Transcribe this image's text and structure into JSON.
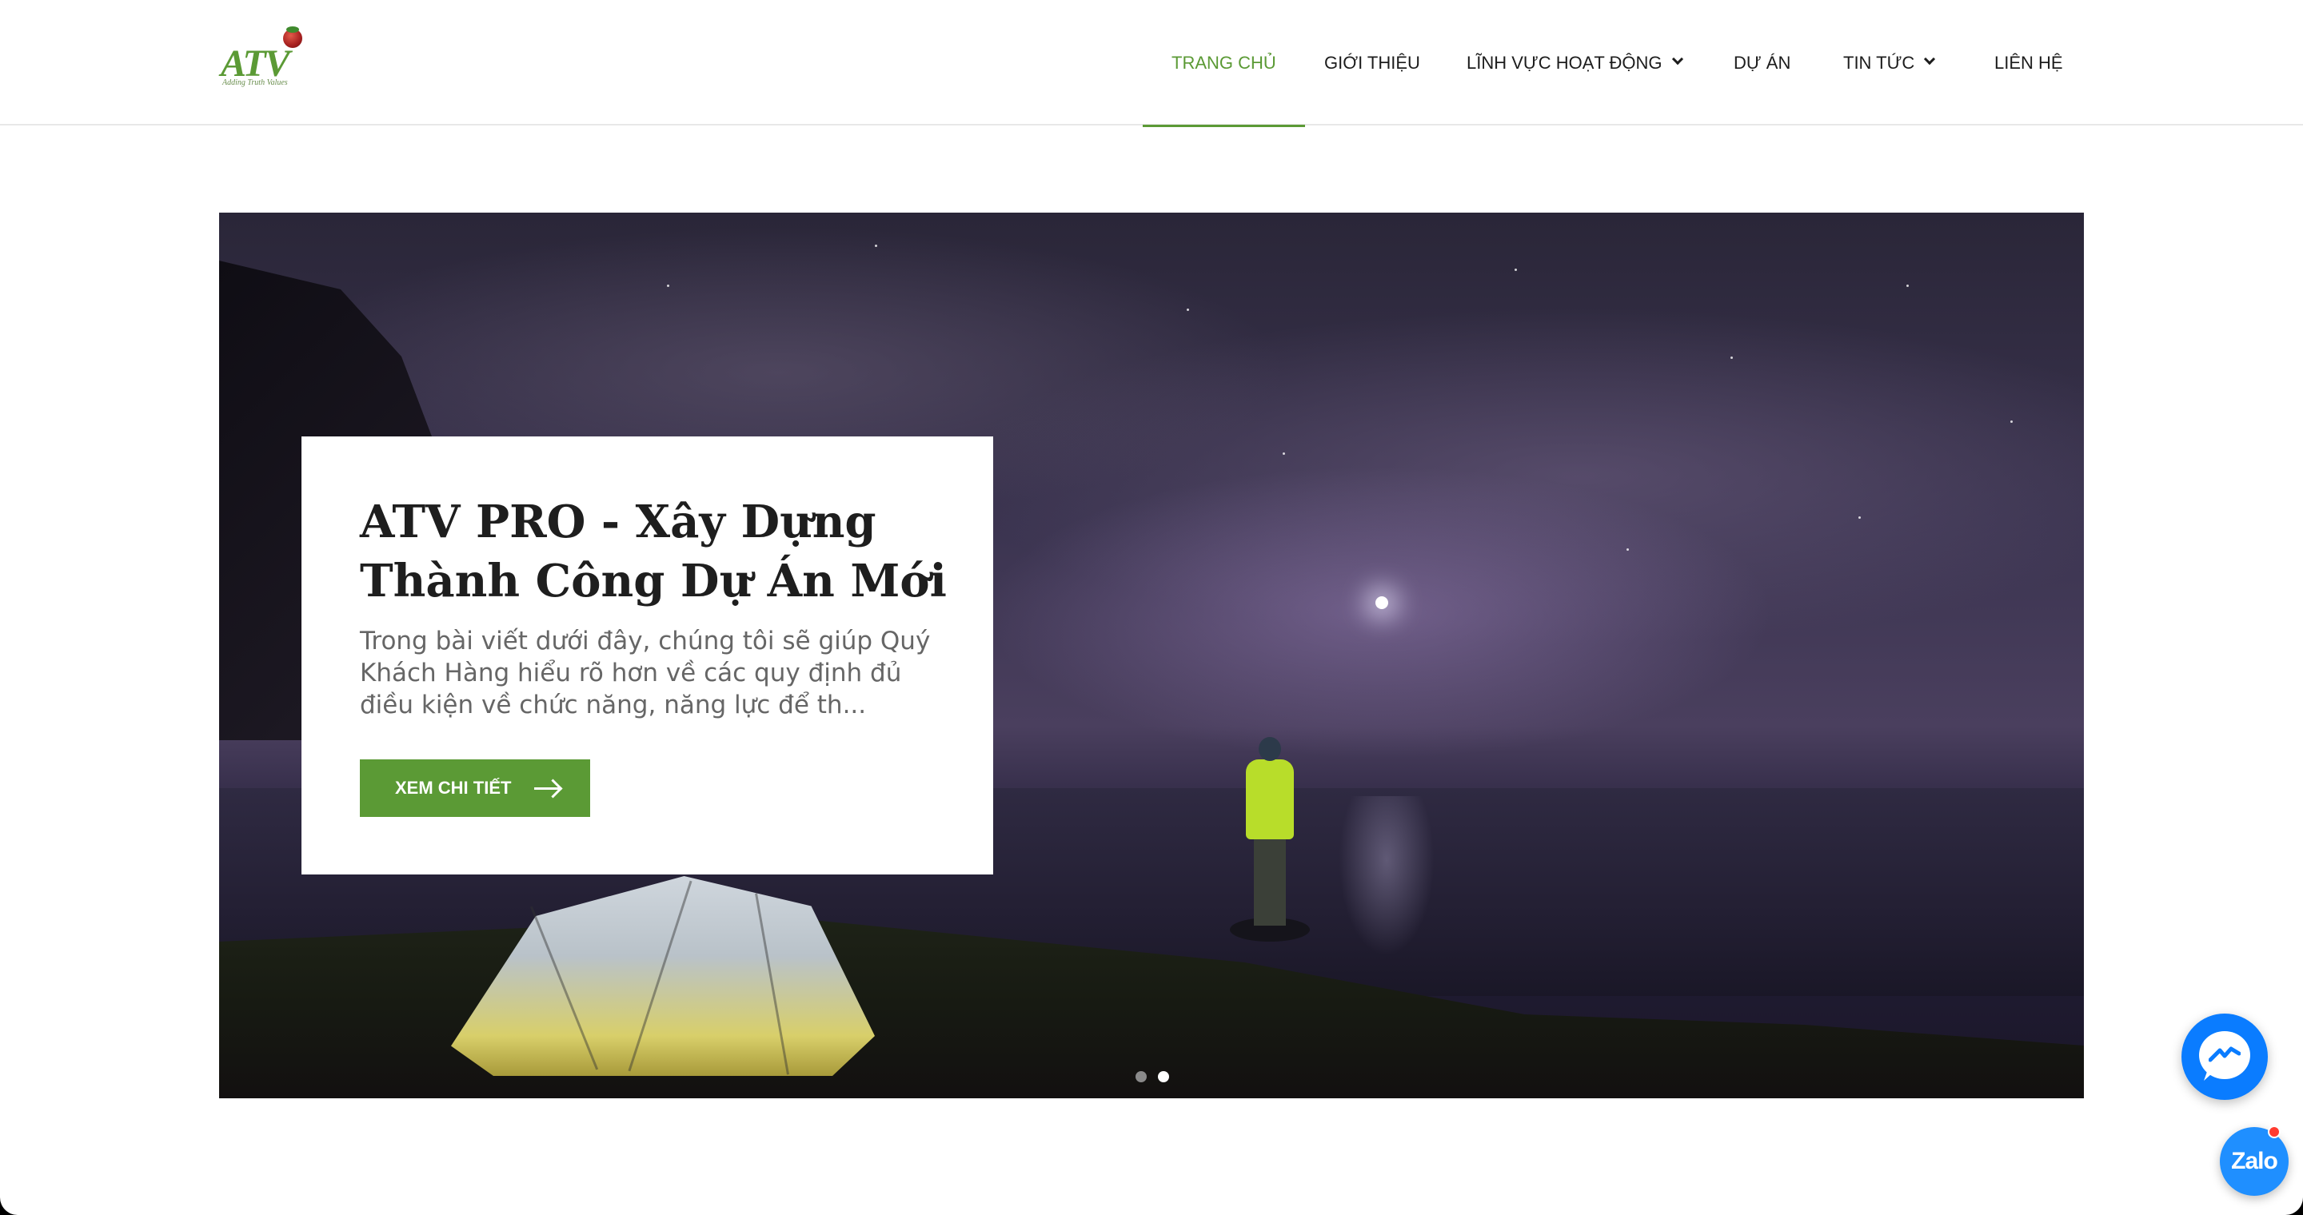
{
  "header": {
    "logo": {
      "text": "ATV",
      "tagline": "Adding Truth Values"
    },
    "nav": [
      {
        "label": "TRANG CHỦ",
        "active": true,
        "has_dropdown": false
      },
      {
        "label": "GIỚI THIỆU",
        "active": false,
        "has_dropdown": false
      },
      {
        "label": "LĨNH VỰC HOẠT ĐỘNG",
        "active": false,
        "has_dropdown": true
      },
      {
        "label": "DỰ ÁN",
        "active": false,
        "has_dropdown": false
      },
      {
        "label": "TIN TỨC",
        "active": false,
        "has_dropdown": true
      },
      {
        "label": "LIÊN HỆ",
        "active": false,
        "has_dropdown": false
      }
    ]
  },
  "hero": {
    "title": "ATV PRO - Xây Dựng Thành Công Dự Án Mới",
    "excerpt": "Trong bài viết dưới đây, chúng tôi sẽ giúp Quý Khách Hàng hiểu rõ hơn về các quy định đủ điều kiện về chức năng, năng lực để th...",
    "button_label": "XEM CHI TIẾT",
    "slides_total": 2,
    "active_slide": 2
  },
  "floating": {
    "messenger_icon": "messenger-icon",
    "zalo_label": "Zalo"
  },
  "colors": {
    "accent": "#5b9a35",
    "messenger": "#0a7cff",
    "zalo": "#1f8fff"
  }
}
